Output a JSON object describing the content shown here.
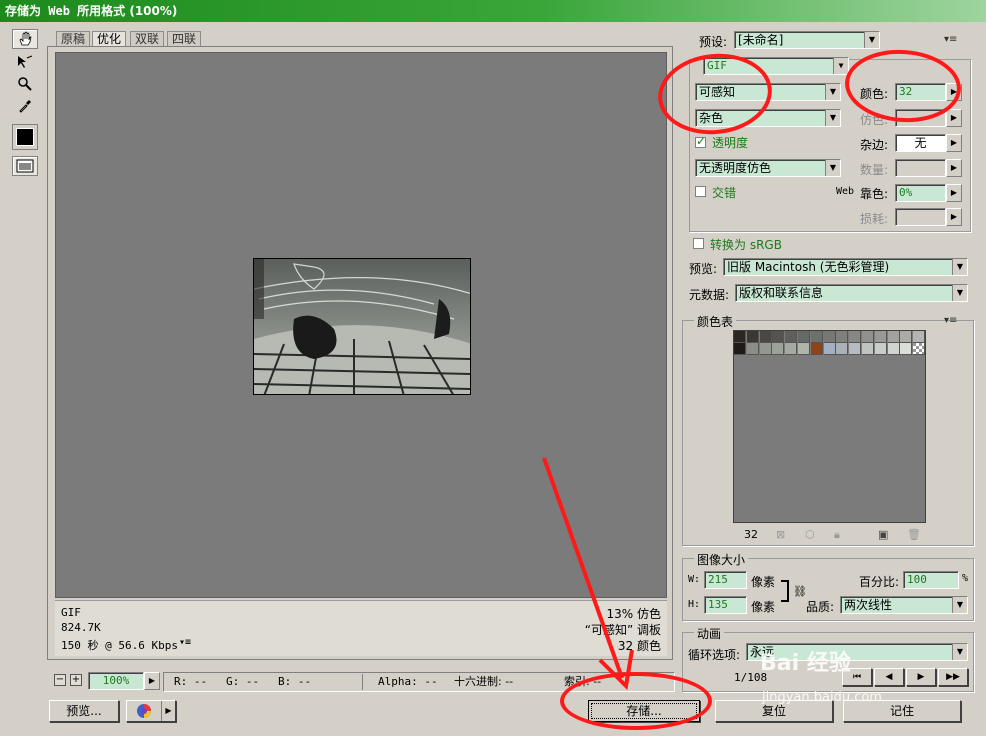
{
  "window": {
    "title_prefix": "存储为",
    "title_web": "Web",
    "title_suffix": "所用格式 (100%)"
  },
  "tools": [
    "hand-icon",
    "slice-select-icon",
    "zoom-icon",
    "eyedropper-icon",
    "color-swatch",
    "toggle-slices-icon"
  ],
  "tool_colors": {
    "eyedropper_color": "#000000"
  },
  "tabs": [
    "原稿",
    "优化",
    "双联",
    "四联"
  ],
  "active_tab": "优化",
  "info": {
    "format": "GIF",
    "size": "824.7K",
    "time": "150 秒 @ 56.6 Kbps",
    "dither_pct": "13% 仿色",
    "palette": "“可感知” 调板",
    "colors": "32 颜色"
  },
  "zoom": {
    "value": "100%"
  },
  "status": {
    "r": "R: --",
    "g": "G: --",
    "b": "B: --",
    "alpha": "Alpha: --",
    "hex": "十六进制: --",
    "index": "索引: --"
  },
  "buttons": {
    "preview": "预览...",
    "save": "存储...",
    "reset": "复位",
    "remember": "记住"
  },
  "settings": {
    "preset_label": "预设:",
    "preset_value": "[未命名]",
    "format_value": "GIF",
    "palette_value": "可感知",
    "dither_value": "杂色",
    "colors_label": "颜色:",
    "colors_value": "32",
    "dither_amount_label": "仿色:",
    "transparency_label": "透明度",
    "transparency_checked": true,
    "matte_label": "杂边:",
    "matte_value": "无",
    "trans_dither_value": "无透明度仿色",
    "amount_label": "数量:",
    "interlaced_label": "交错",
    "web_snap_label_web": "Web",
    "web_snap_label": "靠色:",
    "web_snap_value": "0%",
    "lossy_label": "损耗:",
    "convert_srgb_label": "转换为 sRGB",
    "preview_label": "预览:",
    "preview_value": "旧版 Macintosh (无色彩管理)",
    "metadata_label": "元数据:",
    "metadata_value": "版权和联系信息"
  },
  "color_table": {
    "title": "颜色表",
    "count": "32",
    "swatches": [
      "#2a2622",
      "#3b3834",
      "#4a4844",
      "#55534f",
      "#5f605c",
      "#666a66",
      "#6e706c",
      "#777874",
      "#7f807c",
      "#878884",
      "#90918d",
      "#999a96",
      "#a2a39f",
      "#abaca8",
      "#b4b5b1",
      "#1e1a17",
      "#8a8e88",
      "#939790",
      "#9ca29a",
      "#a5aba3",
      "#b1b4ab",
      "#8c4418",
      "#a4afc0",
      "#aab2b8",
      "#b6bbbf",
      "#c0c3bf",
      "#c9ccc8",
      "#d2d4d0",
      "#dcdeda",
      "checker"
    ]
  },
  "image_size": {
    "title": "图像大小",
    "w_label": "W:",
    "w_value": "215",
    "h_label": "H:",
    "h_value": "135",
    "unit": "像素",
    "percent_label": "百分比:",
    "percent_value": "100",
    "percent_unit": "%",
    "quality_label": "品质:",
    "quality_value": "两次线性"
  },
  "animation": {
    "title": "动画",
    "loop_label": "循环选项:",
    "loop_value": "永远",
    "frame_counter": "1/108"
  },
  "watermark": {
    "logo": "Bai 经验",
    "url": "jingyan.baidu.com"
  }
}
